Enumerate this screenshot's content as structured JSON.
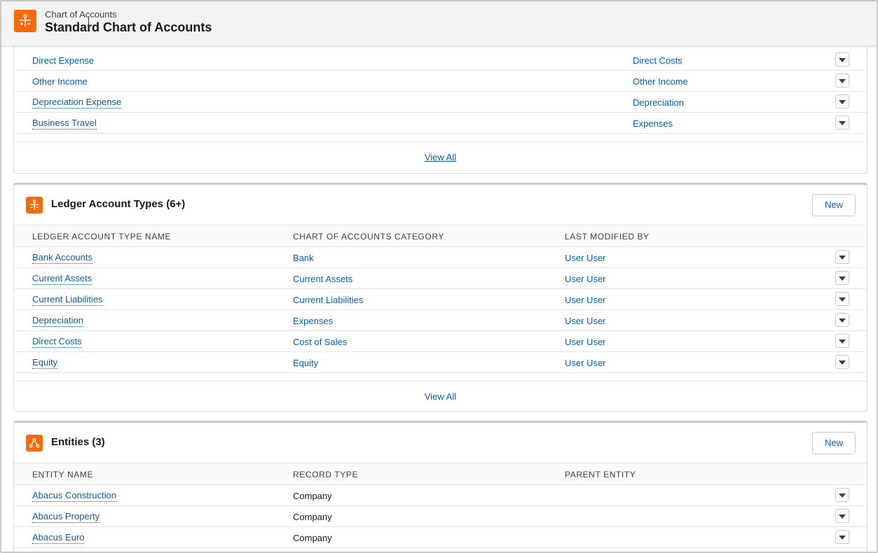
{
  "header": {
    "object_label": "Chart of Accounts",
    "record_title": "Standard Chart of Accounts"
  },
  "gl_accounts_section": {
    "rows": [
      {
        "name": "Direct Expense",
        "type": "Direct Costs"
      },
      {
        "name": "Other Income",
        "type": "Other Income"
      },
      {
        "name": "Depreciation Expense",
        "type": "Depreciation"
      },
      {
        "name": "Business Travel",
        "type": "Expenses"
      }
    ],
    "view_all": "View All"
  },
  "ledger_account_types": {
    "title": "Ledger Account Types (6+)",
    "new_label": "New",
    "columns": [
      "LEDGER ACCOUNT TYPE NAME",
      "CHART OF ACCOUNTS CATEGORY",
      "LAST MODIFIED BY"
    ],
    "rows": [
      {
        "name": "Bank Accounts",
        "category": "Bank",
        "modified_by": "User User"
      },
      {
        "name": "Current Assets",
        "category": "Current Assets",
        "modified_by": "User User"
      },
      {
        "name": "Current Liabilities",
        "category": "Current Liabilities",
        "modified_by": "User User"
      },
      {
        "name": "Depreciation",
        "category": "Expenses",
        "modified_by": "User User"
      },
      {
        "name": "Direct Costs",
        "category": "Cost of Sales",
        "modified_by": "User User"
      },
      {
        "name": "Equity",
        "category": "Equity",
        "modified_by": "User User"
      }
    ],
    "view_all": "View All"
  },
  "entities": {
    "title": "Entities (3)",
    "new_label": "New",
    "columns": [
      "ENTITY NAME",
      "RECORD TYPE",
      "PARENT ENTITY"
    ],
    "rows": [
      {
        "name": "Abacus Construction",
        "record_type": "Company",
        "parent": ""
      },
      {
        "name": "Abacus Property",
        "record_type": "Company",
        "parent": ""
      },
      {
        "name": "Abacus Euro",
        "record_type": "Company",
        "parent": ""
      }
    ]
  },
  "icons": {
    "header": "ledger-icon",
    "ledger_types": "ledger-icon",
    "entities": "hierarchy-icon"
  },
  "colors": {
    "icon_bg": "#f76a0c",
    "link": "#0b5cab"
  }
}
